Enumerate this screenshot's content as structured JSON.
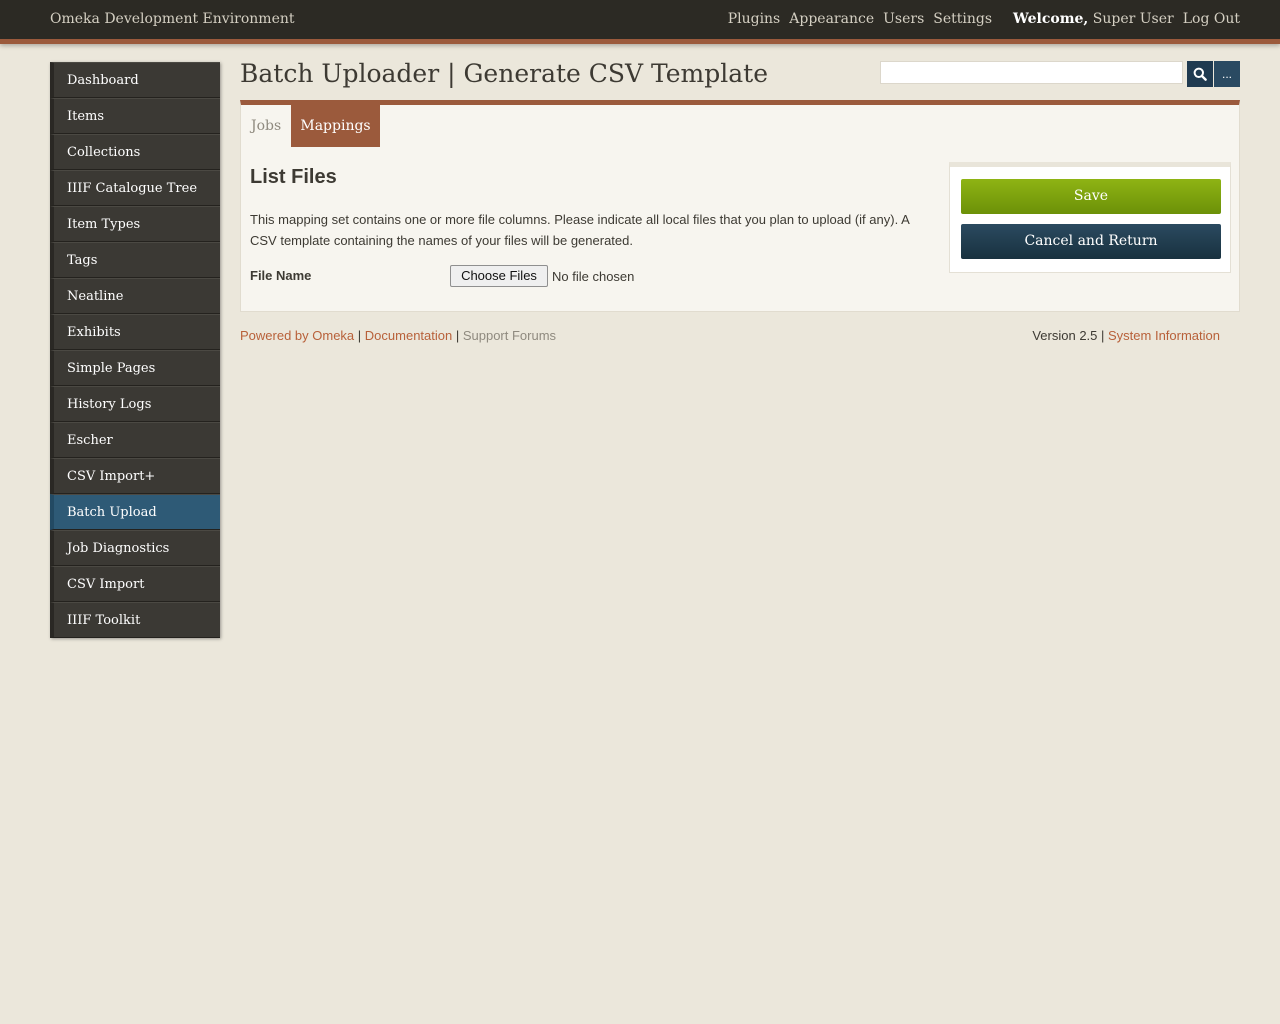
{
  "header": {
    "site_title": "Omeka Development Environment",
    "nav": [
      "Plugins",
      "Appearance",
      "Users",
      "Settings"
    ],
    "welcome_word": "Welcome,",
    "user_name": "Super User",
    "logout": "Log Out"
  },
  "sidebar": {
    "items": [
      {
        "label": "Dashboard"
      },
      {
        "label": "Items"
      },
      {
        "label": "Collections"
      },
      {
        "label": "IIIF Catalogue Tree"
      },
      {
        "label": "Item Types"
      },
      {
        "label": "Tags"
      },
      {
        "label": "Neatline"
      },
      {
        "label": "Exhibits"
      },
      {
        "label": "Simple Pages"
      },
      {
        "label": "History Logs"
      },
      {
        "label": "Escher"
      },
      {
        "label": "CSV Import+"
      },
      {
        "label": "Batch Upload"
      },
      {
        "label": "Job Diagnostics"
      },
      {
        "label": "CSV Import"
      },
      {
        "label": "IIIF Toolkit"
      }
    ],
    "active": "Batch Upload"
  },
  "page": {
    "title": "Batch Uploader | Generate CSV Template"
  },
  "search": {
    "value": "",
    "submit_icon": "search-icon",
    "advanced_label": "..."
  },
  "tabs": [
    {
      "label": "Jobs",
      "active": false
    },
    {
      "label": "Mappings",
      "active": true
    }
  ],
  "form": {
    "section_title": "List Files",
    "description": "This mapping set contains one or more file columns. Please indicate all local files that you plan to upload (if any). A CSV template containing the names of your files will be generated.",
    "file_label": "File Name",
    "choose_button": "Choose Files",
    "file_status": "No file chosen"
  },
  "actions": {
    "save": "Save",
    "cancel": "Cancel and Return"
  },
  "footer": {
    "powered_by": "Powered by Omeka",
    "documentation": "Documentation",
    "support": "Support Forums",
    "version": "Version 2.5",
    "system_info": "System Information"
  },
  "colors": {
    "topbar": "#2c2a24",
    "accent": "#9b5a3c",
    "active_nav": "#2e5a76",
    "save": "#7ea30e",
    "cancel": "#223e51",
    "link": "#b8613a"
  }
}
